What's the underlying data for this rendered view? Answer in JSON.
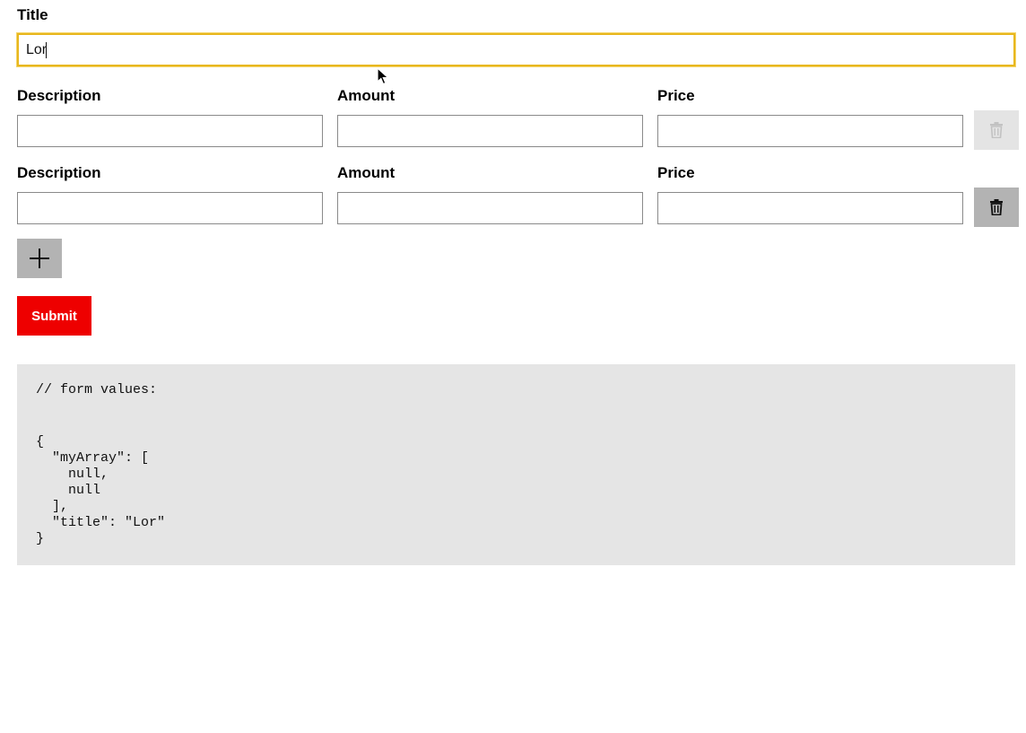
{
  "form": {
    "title_label": "Title",
    "title_value": "Lor",
    "rows": [
      {
        "description_label": "Description",
        "amount_label": "Amount",
        "price_label": "Price",
        "description_value": "",
        "amount_value": "",
        "price_value": "",
        "delete_icon": "trash-icon",
        "delete_enabled": false
      },
      {
        "description_label": "Description",
        "amount_label": "Amount",
        "price_label": "Price",
        "description_value": "",
        "amount_value": "",
        "price_value": "",
        "delete_icon": "trash-icon",
        "delete_enabled": true
      }
    ],
    "add_icon": "plus-icon",
    "submit_label": "Submit"
  },
  "output": {
    "comment": "// form values:",
    "json_text": "{\n  \"myArray\": [\n    null,\n    null\n  ],\n  \"title\": \"Lor\"\n}"
  },
  "colors": {
    "focus_border": "#e8b71e",
    "submit_background": "#ee0000",
    "icon_button_background": "#b3b3b3",
    "disabled_button_background": "#e4e4e4",
    "code_panel_background": "#e5e5e5"
  }
}
